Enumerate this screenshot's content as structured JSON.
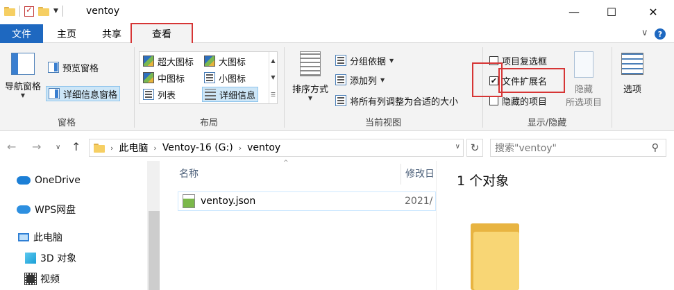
{
  "window": {
    "title": "ventoy",
    "minimize": "—",
    "maximize": "☐",
    "close": "✕"
  },
  "ribbon_tabs": [
    "文件",
    "主页",
    "共享",
    "查看"
  ],
  "ribbon_controls": {
    "expand": "∨",
    "help": "?"
  },
  "panes": {
    "navigation_pane": "导航窗格",
    "preview_pane": "预览窗格",
    "details_pane": "详细信息窗格",
    "group_label": "窗格"
  },
  "layout": {
    "extra_large_icons": "超大图标",
    "large_icons": "大图标",
    "medium_icons": "中图标",
    "small_icons": "小图标",
    "list": "列表",
    "details": "详细信息",
    "group_label": "布局",
    "selected": "详细信息"
  },
  "current_view": {
    "sort_by": "排序方式",
    "group_by": "分组依据",
    "add_columns": "添加列",
    "size_all_columns": "将所有列调整为合适的大小",
    "group_label": "当前视图"
  },
  "show_hide": {
    "item_checkboxes": "项目复选框",
    "item_checkboxes_checked": false,
    "file_extensions": "文件扩展名",
    "file_extensions_checked": true,
    "hidden_items": "隐藏的项目",
    "hidden_items_checked": false,
    "hide_selected_line1": "隐藏",
    "hide_selected_line2": "所选项目",
    "group_label": "显示/隐藏"
  },
  "options": {
    "label": "选项"
  },
  "address_bar": {
    "segments": [
      "此电脑",
      "Ventoy-16 (G:)",
      "ventoy"
    ],
    "search_placeholder": "搜索\"ventoy\""
  },
  "nav_pane": {
    "items": [
      "OneDrive",
      "WPS网盘",
      "此电脑",
      "3D 对象",
      "视频"
    ]
  },
  "file_list": {
    "columns": [
      "名称",
      "修改日"
    ],
    "rows": [
      {
        "name": "ventoy.json",
        "modified": "2021/"
      }
    ]
  },
  "preview": {
    "title": "1 个对象"
  },
  "colors": {
    "file_tab": "#1e68c0",
    "highlight_border": "#d63535",
    "selection": "#cde6f7"
  }
}
